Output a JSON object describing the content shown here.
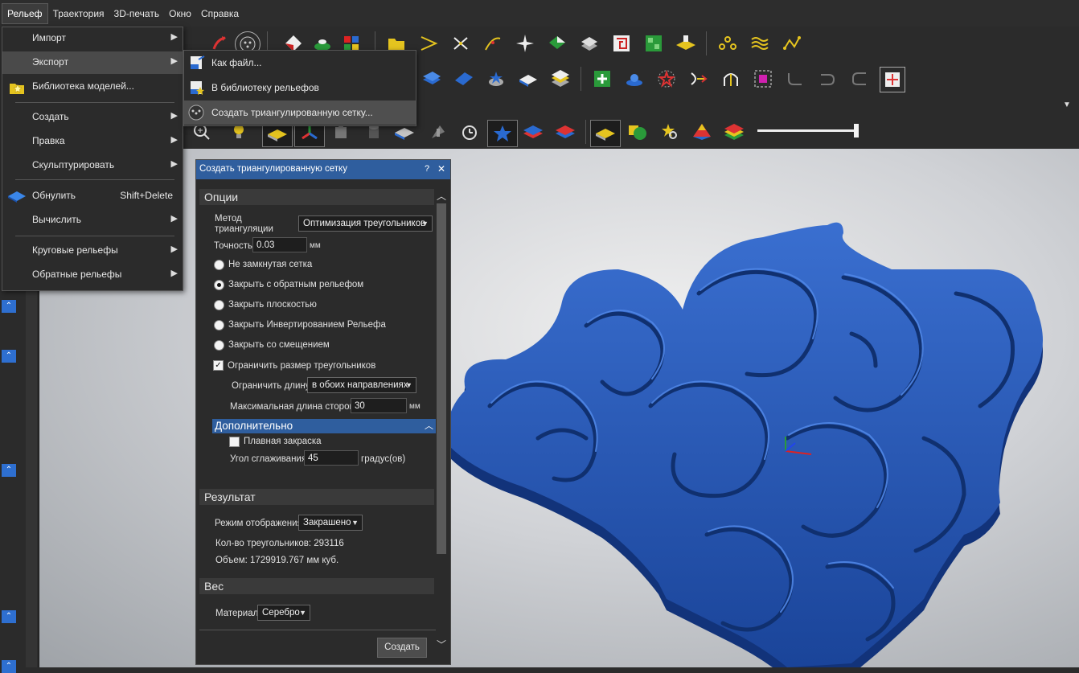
{
  "menubar": [
    "Рельеф",
    "Траектория",
    "3D-печать",
    "Окно",
    "Справка"
  ],
  "menu": {
    "items": [
      {
        "label": "Импорт",
        "shortcut": "",
        "submenu": true
      },
      {
        "label": "Экспорт",
        "shortcut": "",
        "submenu": true
      },
      {
        "label": "Библиотека моделей...",
        "shortcut": "",
        "submenu": false
      },
      {
        "label": "Создать",
        "shortcut": "",
        "submenu": true
      },
      {
        "label": "Правка",
        "shortcut": "",
        "submenu": true
      },
      {
        "label": "Скульптурировать",
        "shortcut": "",
        "submenu": true
      },
      {
        "label": "Обнулить",
        "shortcut": "Shift+Delete",
        "submenu": false
      },
      {
        "label": "Вычислить",
        "shortcut": "",
        "submenu": true
      },
      {
        "label": "Круговые рельефы",
        "shortcut": "",
        "submenu": true
      },
      {
        "label": "Обратные рельефы",
        "shortcut": "",
        "submenu": true
      }
    ],
    "arrow": "▶"
  },
  "submenu": {
    "items": [
      "Как файл...",
      "В библиотеку рельефов",
      "Создать триангулированную сетку..."
    ]
  },
  "dialog": {
    "title": "Создать триангулированную сетку",
    "help": "?",
    "close": "✕",
    "options": {
      "header": "Опции",
      "method_label_1": "Метод",
      "method_label_2": "триангуляции",
      "method_value": "Оптимизация треугольников",
      "accuracy_label": "Точность",
      "accuracy_value": "0.03",
      "accuracy_unit": "мм",
      "radios": [
        {
          "label": "Не замкнутая сетка",
          "checked": false
        },
        {
          "label": "Закрыть с обратным рельефом",
          "checked": true
        },
        {
          "label": "Закрыть плоскостью",
          "checked": false
        },
        {
          "label": "Закрыть Инвертированием Рельефа",
          "checked": false
        },
        {
          "label": "Закрыть со смещением",
          "checked": false
        }
      ],
      "limit_check_label": "Ограничить размер треугольников",
      "limit_check_mark": "✓",
      "limit_length_label": "Ограничить длину",
      "limit_length_value": "в обоих направлениях",
      "max_side_label": "Максимальная длина стороны",
      "max_side_value": "30",
      "max_side_unit": "мм"
    },
    "advanced": {
      "header": "Дополнительно",
      "smooth_label": "Плавная закраска",
      "angle_label": "Угол сглаживания",
      "angle_value": "45",
      "angle_unit": "градус(ов)"
    },
    "result": {
      "header": "Результат",
      "display_label": "Режим отображения",
      "display_value": "Закрашено",
      "triangles": "Кол-во треугольников: 293116",
      "volume": "Объем: 1729919.767 мм куб."
    },
    "weight": {
      "header": "Вес",
      "material_label": "Материал",
      "material_value": "Серебро"
    },
    "create_button": "Создать"
  },
  "colors": {
    "accent": "#2f5e9e",
    "relief_blue": "#2757b8",
    "relief_dark": "#163a85"
  }
}
